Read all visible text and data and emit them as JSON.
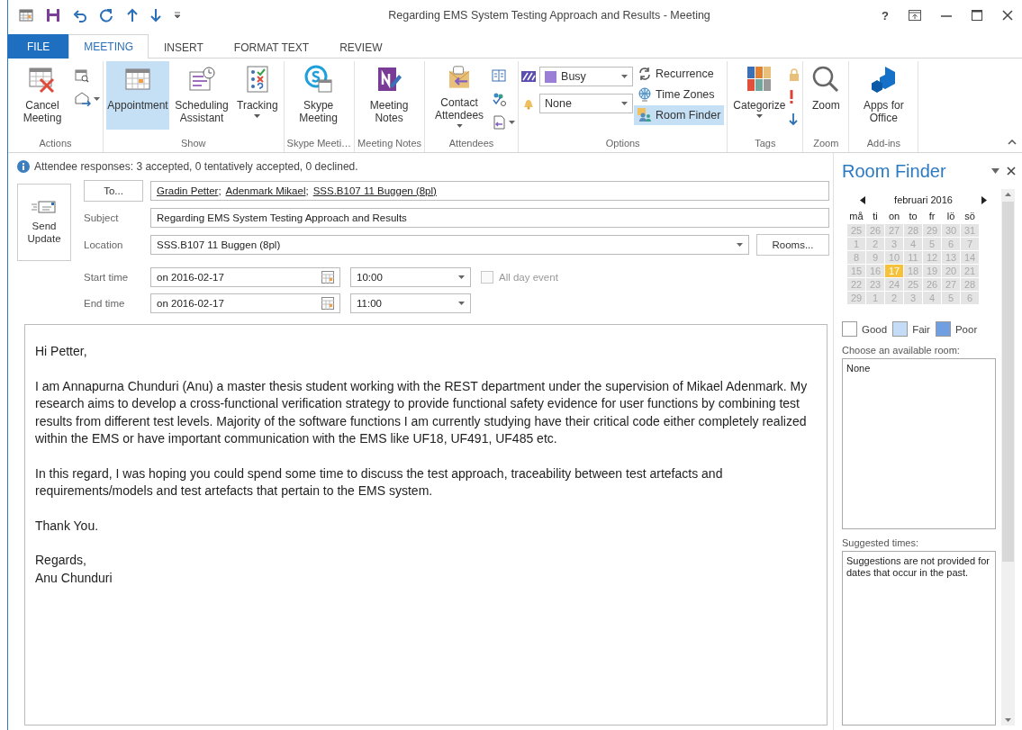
{
  "window": {
    "title": "Regarding EMS System Testing Approach and Results - Meeting",
    "help": "?"
  },
  "tabs": [
    {
      "label": "FILE",
      "kind": "file",
      "selected": false
    },
    {
      "label": "MEETING",
      "kind": "tab",
      "selected": true
    },
    {
      "label": "INSERT",
      "kind": "tab",
      "selected": false
    },
    {
      "label": "FORMAT TEXT",
      "kind": "tab",
      "selected": false
    },
    {
      "label": "REVIEW",
      "kind": "tab",
      "selected": false
    }
  ],
  "ribbon": {
    "groups": [
      {
        "label": "Actions",
        "buttons": [
          {
            "label": "Cancel Meeting",
            "selected": false
          }
        ]
      },
      {
        "label": "Show",
        "buttons": [
          {
            "label": "Appointment",
            "selected": true
          },
          {
            "label": "Scheduling Assistant",
            "selected": false
          },
          {
            "label": "Tracking",
            "selected": false,
            "dropdown": true
          }
        ]
      },
      {
        "label": "Skype Meeti…",
        "buttons": [
          {
            "label": "Skype Meeting",
            "selected": false
          }
        ]
      },
      {
        "label": "Meeting Notes",
        "buttons": [
          {
            "label": "Meeting Notes",
            "selected": false
          }
        ]
      },
      {
        "label": "Attendees",
        "buttons": [
          {
            "label": "Contact Attendees",
            "selected": false,
            "dropdown": true
          }
        ]
      },
      {
        "label": "Options",
        "show_as": {
          "value": "Busy",
          "color": "#9b7fd6"
        },
        "reminder": {
          "value": "None"
        },
        "buttons": [
          {
            "label": "Recurrence",
            "selected": false
          },
          {
            "label": "Time Zones",
            "selected": false
          },
          {
            "label": "Room Finder",
            "selected": true
          }
        ]
      },
      {
        "label": "Tags",
        "buttons": [
          {
            "label": "Categorize",
            "selected": false,
            "dropdown": true
          }
        ]
      },
      {
        "label": "Zoom",
        "buttons": [
          {
            "label": "Zoom",
            "selected": false
          }
        ]
      },
      {
        "label": "Add-ins",
        "buttons": [
          {
            "label": "Apps for Office",
            "selected": false
          }
        ]
      }
    ]
  },
  "info": "Attendee responses: 3 accepted, 0 tentatively accepted, 0 declined.",
  "send_button": "Send Update",
  "to": {
    "button": "To...",
    "separator": ";",
    "recipients": [
      "Gradin Petter",
      "Adenmark Mikael",
      "SSS.B107 11 Buggen (8pl)"
    ]
  },
  "subject": {
    "label": "Subject",
    "value": "Regarding EMS System Testing Approach and Results"
  },
  "location": {
    "label": "Location",
    "value": "SSS.B107 11 Buggen (8pl)",
    "button": "Rooms..."
  },
  "start": {
    "label": "Start time",
    "date": "on 2016-02-17",
    "time": "10:00"
  },
  "all_day": {
    "label": "All day event",
    "checked": false,
    "disabled": true
  },
  "end": {
    "label": "End time",
    "date": "on 2016-02-17",
    "time": "11:00"
  },
  "body": [
    [
      "Hi Petter,"
    ],
    [
      "I am Annapurna Chunduri (Anu) a master thesis student working with the REST department under the supervision of Mikael Adenmark. My research aims to develop a cross-functional verification strategy to provide functional safety evidence for user functions by combining test results from different test levels. Majority of the software functions I am currently studying have their critical code either completely realized within the EMS or have important communication with the EMS like UF18, UF491, UF485 etc."
    ],
    [
      "In this regard, I was hoping you could spend some time to discuss the test approach, traceability between test artefacts and requirements/models and test artefacts that pertain to the EMS system."
    ],
    [
      "Thank You."
    ],
    [
      "Regards,",
      "Anu Chunduri"
    ]
  ],
  "room_finder": {
    "title": "Room Finder",
    "month": "februari 2016",
    "weekdays": [
      "må",
      "ti",
      "on",
      "to",
      "fr",
      "lö",
      "sö"
    ],
    "weeks": [
      [
        {
          "day": "25",
          "selected": false
        },
        {
          "day": "26",
          "selected": false
        },
        {
          "day": "27",
          "selected": false
        },
        {
          "day": "28",
          "selected": false
        },
        {
          "day": "29",
          "selected": false
        },
        {
          "day": "30",
          "selected": false
        },
        {
          "day": "31",
          "selected": false
        }
      ],
      [
        {
          "day": "1",
          "selected": false
        },
        {
          "day": "2",
          "selected": false
        },
        {
          "day": "3",
          "selected": false
        },
        {
          "day": "4",
          "selected": false
        },
        {
          "day": "5",
          "selected": false
        },
        {
          "day": "6",
          "selected": false
        },
        {
          "day": "7",
          "selected": false
        }
      ],
      [
        {
          "day": "8",
          "selected": false
        },
        {
          "day": "9",
          "selected": false
        },
        {
          "day": "10",
          "selected": false
        },
        {
          "day": "11",
          "selected": false
        },
        {
          "day": "12",
          "selected": false
        },
        {
          "day": "13",
          "selected": false
        },
        {
          "day": "14",
          "selected": false
        }
      ],
      [
        {
          "day": "15",
          "selected": false
        },
        {
          "day": "16",
          "selected": false
        },
        {
          "day": "17",
          "selected": true
        },
        {
          "day": "18",
          "selected": false
        },
        {
          "day": "19",
          "selected": false
        },
        {
          "day": "20",
          "selected": false
        },
        {
          "day": "21",
          "selected": false
        }
      ],
      [
        {
          "day": "22",
          "selected": false
        },
        {
          "day": "23",
          "selected": false
        },
        {
          "day": "24",
          "selected": false
        },
        {
          "day": "25",
          "selected": false
        },
        {
          "day": "26",
          "selected": false
        },
        {
          "day": "27",
          "selected": false
        },
        {
          "day": "28",
          "selected": false
        }
      ],
      [
        {
          "day": "29",
          "selected": false
        },
        {
          "day": "1",
          "selected": false
        },
        {
          "day": "2",
          "selected": false
        },
        {
          "day": "3",
          "selected": false
        },
        {
          "day": "4",
          "selected": false
        },
        {
          "day": "5",
          "selected": false
        },
        {
          "day": "6",
          "selected": false
        }
      ]
    ],
    "legend": [
      {
        "label": "Good",
        "color": "#ffffff"
      },
      {
        "label": "Fair",
        "color": "#c5dcf7"
      },
      {
        "label": "Poor",
        "color": "#6f9fe0"
      }
    ],
    "rooms_label": "Choose an available room:",
    "rooms": [
      "None"
    ],
    "suggested_label": "Suggested times:",
    "suggestions": "Suggestions are not provided for dates that occur in the past."
  }
}
